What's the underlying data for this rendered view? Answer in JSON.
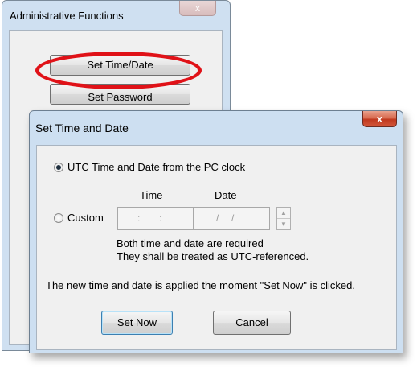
{
  "admin_window": {
    "title": "Administrative Functions",
    "close_glyph": "x",
    "buttons": {
      "set_time_date": "Set Time/Date",
      "set_password": "Set Password"
    }
  },
  "dialog": {
    "title": "Set Time and Date",
    "close_glyph": "x",
    "radio_utc": {
      "label": "UTC Time and Date from the PC clock",
      "checked": true
    },
    "radio_custom": {
      "label": "Custom",
      "checked": false
    },
    "time_header": "Time",
    "date_header": "Date",
    "time_separators": [
      ":",
      ":"
    ],
    "date_separators": [
      "/",
      "/"
    ],
    "spin_up": "▲",
    "spin_down": "▼",
    "note_line_1": "Both time and date are required",
    "note_line_2": "They shall be treated as UTC-referenced.",
    "applied_note": "The new time and date is applied the moment  \"Set Now\" is clicked.",
    "set_now_label": "Set Now",
    "cancel_label": "Cancel"
  },
  "colors": {
    "highlight_ellipse": "#e01218",
    "window_frame": "#cddff1",
    "client_bg": "#f0f0f0",
    "close_button": "#c0391f"
  }
}
